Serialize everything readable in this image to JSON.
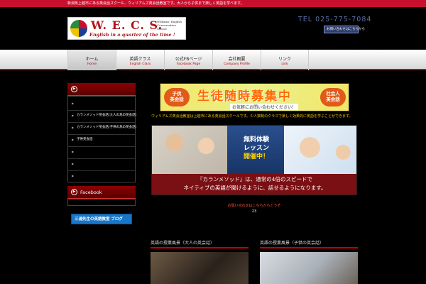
{
  "topbar": {
    "text": "新潟県上越市にある英会話スクール、ウィリアムズ英会話教室です。大人から子供まで楽しく英語を学べます。"
  },
  "logo": {
    "name": "W. E. C. S.",
    "tagline": "English in a quarter of the time !",
    "subtitle": "Williams' English Conversation School"
  },
  "header": {
    "tel": "TEL 025-775-7084",
    "contact_label": "お問い合わせはこちらから"
  },
  "nav": [
    {
      "jp": "ホーム",
      "en": "Home"
    },
    {
      "jp": "英語クラス",
      "en": "English Class"
    },
    {
      "jp": "公式FBページ",
      "en": "Facebook Page"
    },
    {
      "jp": "会社概要",
      "en": "Company Profile"
    },
    {
      "jp": "リンク",
      "en": "Link"
    }
  ],
  "sidebar": {
    "menu_label": "",
    "items": [
      "",
      "カランメソッド英会話(大人の為の英会話)",
      "カランメソッド英会話(子供の為の英会話)",
      "子供英会話",
      "",
      "",
      ""
    ],
    "facebook_label": "Facebook",
    "blog_label": "三浦先生の英語教室 ブログ"
  },
  "recruit": {
    "badge_left": "子供\n英会話",
    "headline": "生徒随時募集中",
    "badge_right": "社会人\n英会話",
    "subline": "お気軽にお問い合わせください！"
  },
  "intro": "ウィリアムズ英会話教室は上越市にある英会話スクールです。少人数制のクラスで楽しく効果的に英語を学ぶことができます。",
  "trial": {
    "line1": "無料体験",
    "line2": "レッスン",
    "line3": "開催中！",
    "caption1": "『カランメソッド』は、通常の4倍のスピードで",
    "caption2": "ネイティブの英語が聞けるように、話せるようになります。"
  },
  "notice": {
    "text": "お問い合わせはこちらからどうぞ",
    "sub": "23"
  },
  "cards": [
    {
      "title": "英語の授業風景（大人の英会話）"
    },
    {
      "title": "英語の授業風景（子供の英会話）"
    }
  ]
}
